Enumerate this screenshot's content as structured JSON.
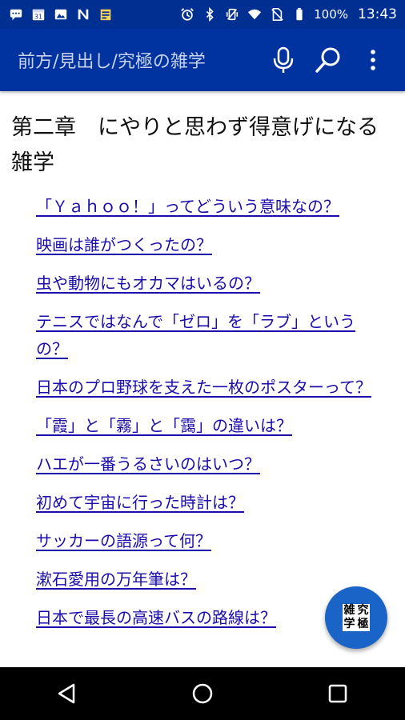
{
  "status_bar": {
    "battery": "100%",
    "time": "13:43",
    "calendar_day": "31",
    "left_icons": [
      "message-icon",
      "calendar-icon",
      "image-icon",
      "n-icon",
      "news-icon"
    ],
    "right_icons": [
      "alarm-icon",
      "bluetooth-icon",
      "vibrate-icon",
      "wifi-icon",
      "no-sim-icon",
      "battery-icon"
    ]
  },
  "app_bar": {
    "title": "前方/見出し/究極の雑学",
    "icons": [
      "mic-icon",
      "search-icon",
      "more-vert-icon"
    ]
  },
  "chapter": {
    "title": "第二章　にやりと思わず得意げになる雑学"
  },
  "articles": [
    "「Ｙａｈｏｏ！」ってどういう意味なの？",
    "映画は誰がつくったの？",
    "虫や動物にもオカマはいるの？",
    "テニスではなんで「ゼロ」を「ラブ」というの？",
    "日本のプロ野球を支えた一枚のポスターって？",
    "「霞」と「霧」と「靄」の違いは？",
    "ハエが一番うるさいのはいつ？",
    "初めて宇宙に行った時計は？",
    "サッカーの語源って何？",
    "漱石愛用の万年筆は？",
    "日本で最長の高速バスの路線は？"
  ],
  "fab": {
    "logo_chars": [
      "雑",
      "究",
      "学",
      "極"
    ]
  },
  "colors": {
    "status_bar": "#002f92",
    "app_bar": "#0033a0",
    "link": "#1a0dab",
    "fab": "#1a63c7"
  },
  "nav_bar": {
    "icons": [
      "back-icon",
      "home-icon",
      "recents-icon"
    ]
  }
}
